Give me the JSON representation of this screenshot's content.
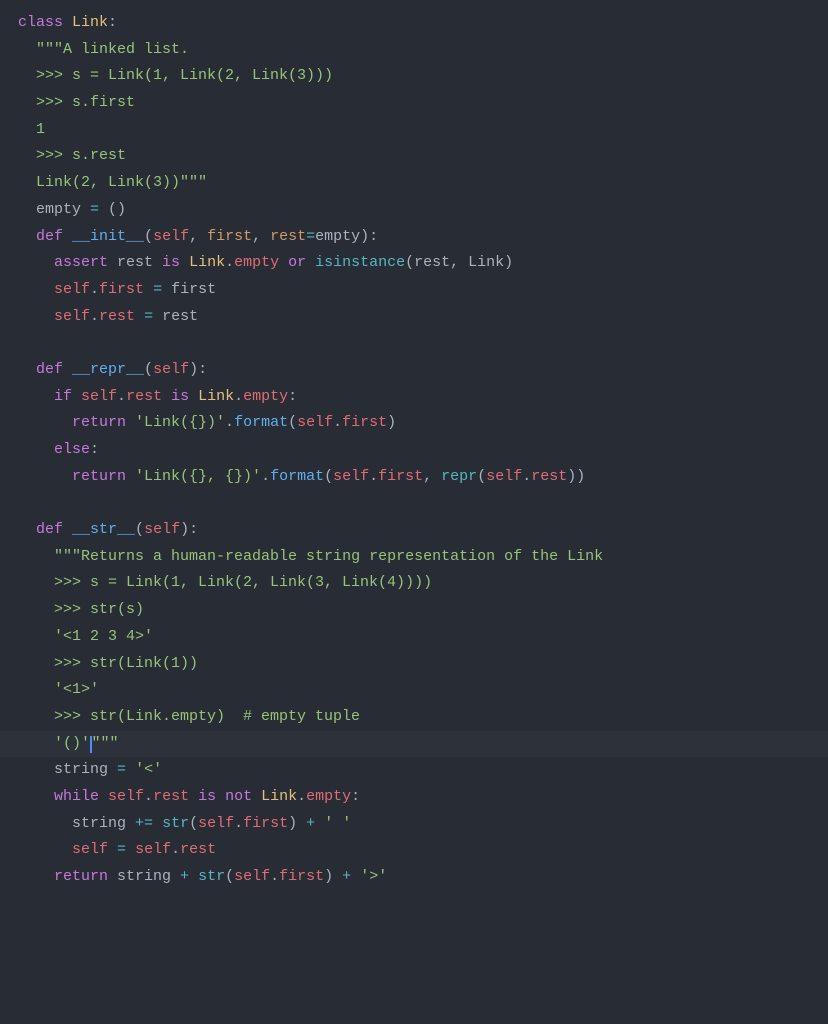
{
  "language": "python",
  "theme": "one-dark",
  "cursor": {
    "line_index": 29,
    "after_token_index": 3
  },
  "highlighted_line_index": 29,
  "lines": [
    [
      {
        "t": "class ",
        "c": "kw"
      },
      {
        "t": "Link",
        "c": "cls"
      },
      {
        "t": ":",
        "c": "punct"
      }
    ],
    [
      {
        "t": "  ",
        "c": "punct"
      },
      {
        "t": "\"\"\"A linked list.",
        "c": "str"
      }
    ],
    [
      {
        "t": "  >>> s = Link(1, Link(2, Link(3)))",
        "c": "str"
      }
    ],
    [
      {
        "t": "  >>> s.first",
        "c": "str"
      }
    ],
    [
      {
        "t": "  1",
        "c": "str"
      }
    ],
    [
      {
        "t": "  >>> s.rest",
        "c": "str"
      }
    ],
    [
      {
        "t": "  Link(2, Link(3))\"\"\"",
        "c": "str"
      }
    ],
    [
      {
        "t": "  empty ",
        "c": "punct"
      },
      {
        "t": "=",
        "c": "op"
      },
      {
        "t": " ()",
        "c": "punct"
      }
    ],
    [
      {
        "t": "  ",
        "c": "punct"
      },
      {
        "t": "def ",
        "c": "kw"
      },
      {
        "t": "__init__",
        "c": "fn"
      },
      {
        "t": "(",
        "c": "punct"
      },
      {
        "t": "self",
        "c": "self"
      },
      {
        "t": ", ",
        "c": "punct"
      },
      {
        "t": "first",
        "c": "param"
      },
      {
        "t": ", ",
        "c": "punct"
      },
      {
        "t": "rest",
        "c": "param"
      },
      {
        "t": "=",
        "c": "op"
      },
      {
        "t": "empty",
        "c": "punct"
      },
      {
        "t": "):",
        "c": "punct"
      }
    ],
    [
      {
        "t": "    ",
        "c": "punct"
      },
      {
        "t": "assert ",
        "c": "kw"
      },
      {
        "t": "rest ",
        "c": "punct"
      },
      {
        "t": "is ",
        "c": "kw"
      },
      {
        "t": "Link",
        "c": "cls"
      },
      {
        "t": ".",
        "c": "punct"
      },
      {
        "t": "empty",
        "c": "attr"
      },
      {
        "t": " ",
        "c": "punct"
      },
      {
        "t": "or ",
        "c": "kw"
      },
      {
        "t": "isinstance",
        "c": "builtin"
      },
      {
        "t": "(rest, Link)",
        "c": "punct"
      }
    ],
    [
      {
        "t": "    ",
        "c": "punct"
      },
      {
        "t": "self",
        "c": "self"
      },
      {
        "t": ".",
        "c": "punct"
      },
      {
        "t": "first",
        "c": "attr"
      },
      {
        "t": " ",
        "c": "punct"
      },
      {
        "t": "=",
        "c": "op"
      },
      {
        "t": " first",
        "c": "punct"
      }
    ],
    [
      {
        "t": "    ",
        "c": "punct"
      },
      {
        "t": "self",
        "c": "self"
      },
      {
        "t": ".",
        "c": "punct"
      },
      {
        "t": "rest",
        "c": "attr"
      },
      {
        "t": " ",
        "c": "punct"
      },
      {
        "t": "=",
        "c": "op"
      },
      {
        "t": " rest",
        "c": "punct"
      }
    ],
    [
      {
        "t": " ",
        "c": "punct"
      }
    ],
    [
      {
        "t": "  ",
        "c": "punct"
      },
      {
        "t": "def ",
        "c": "kw"
      },
      {
        "t": "__repr__",
        "c": "fn"
      },
      {
        "t": "(",
        "c": "punct"
      },
      {
        "t": "self",
        "c": "self"
      },
      {
        "t": "):",
        "c": "punct"
      }
    ],
    [
      {
        "t": "    ",
        "c": "punct"
      },
      {
        "t": "if ",
        "c": "kw"
      },
      {
        "t": "self",
        "c": "self"
      },
      {
        "t": ".",
        "c": "punct"
      },
      {
        "t": "rest",
        "c": "attr"
      },
      {
        "t": " ",
        "c": "punct"
      },
      {
        "t": "is ",
        "c": "kw"
      },
      {
        "t": "Link",
        "c": "cls"
      },
      {
        "t": ".",
        "c": "punct"
      },
      {
        "t": "empty",
        "c": "attr"
      },
      {
        "t": ":",
        "c": "punct"
      }
    ],
    [
      {
        "t": "      ",
        "c": "punct"
      },
      {
        "t": "return ",
        "c": "kw"
      },
      {
        "t": "'Link({})'",
        "c": "str"
      },
      {
        "t": ".",
        "c": "punct"
      },
      {
        "t": "format",
        "c": "fn"
      },
      {
        "t": "(",
        "c": "punct"
      },
      {
        "t": "self",
        "c": "self"
      },
      {
        "t": ".",
        "c": "punct"
      },
      {
        "t": "first",
        "c": "attr"
      },
      {
        "t": ")",
        "c": "punct"
      }
    ],
    [
      {
        "t": "    ",
        "c": "punct"
      },
      {
        "t": "else",
        "c": "kw"
      },
      {
        "t": ":",
        "c": "punct"
      }
    ],
    [
      {
        "t": "      ",
        "c": "punct"
      },
      {
        "t": "return ",
        "c": "kw"
      },
      {
        "t": "'Link({}, {})'",
        "c": "str"
      },
      {
        "t": ".",
        "c": "punct"
      },
      {
        "t": "format",
        "c": "fn"
      },
      {
        "t": "(",
        "c": "punct"
      },
      {
        "t": "self",
        "c": "self"
      },
      {
        "t": ".",
        "c": "punct"
      },
      {
        "t": "first",
        "c": "attr"
      },
      {
        "t": ", ",
        "c": "punct"
      },
      {
        "t": "repr",
        "c": "builtin"
      },
      {
        "t": "(",
        "c": "punct"
      },
      {
        "t": "self",
        "c": "self"
      },
      {
        "t": ".",
        "c": "punct"
      },
      {
        "t": "rest",
        "c": "attr"
      },
      {
        "t": "))",
        "c": "punct"
      }
    ],
    [
      {
        "t": " ",
        "c": "punct"
      }
    ],
    [
      {
        "t": "  ",
        "c": "punct"
      },
      {
        "t": "def ",
        "c": "kw"
      },
      {
        "t": "__str__",
        "c": "fn"
      },
      {
        "t": "(",
        "c": "punct"
      },
      {
        "t": "self",
        "c": "self"
      },
      {
        "t": "):",
        "c": "punct"
      }
    ],
    [
      {
        "t": "    ",
        "c": "punct"
      },
      {
        "t": "\"\"\"Returns a human-readable string representation of the Link",
        "c": "str"
      }
    ],
    [
      {
        "t": "    >>> s = Link(1, Link(2, Link(3, Link(4))))",
        "c": "str"
      }
    ],
    [
      {
        "t": "    >>> str(s)",
        "c": "str"
      }
    ],
    [
      {
        "t": "    '<1 2 3 4>'",
        "c": "str"
      }
    ],
    [
      {
        "t": "    >>> str(Link(1))",
        "c": "str"
      }
    ],
    [
      {
        "t": "    '<1>'",
        "c": "str"
      }
    ],
    [
      {
        "t": "    >>> str(Link.empty)  # empty tuple",
        "c": "str"
      }
    ],
    [
      {
        "t": "    '()'",
        "c": "str"
      },
      {
        "t": "\"\"\"",
        "c": "str"
      }
    ],
    [
      {
        "t": "    string ",
        "c": "punct"
      },
      {
        "t": "=",
        "c": "op"
      },
      {
        "t": " ",
        "c": "punct"
      },
      {
        "t": "'<'",
        "c": "str"
      }
    ],
    [
      {
        "t": "    ",
        "c": "punct"
      },
      {
        "t": "while ",
        "c": "kw"
      },
      {
        "t": "self",
        "c": "self"
      },
      {
        "t": ".",
        "c": "punct"
      },
      {
        "t": "rest",
        "c": "attr"
      },
      {
        "t": " ",
        "c": "punct"
      },
      {
        "t": "is ",
        "c": "kw"
      },
      {
        "t": "not ",
        "c": "kw"
      },
      {
        "t": "Link",
        "c": "cls"
      },
      {
        "t": ".",
        "c": "punct"
      },
      {
        "t": "empty",
        "c": "attr"
      },
      {
        "t": ":",
        "c": "punct"
      }
    ],
    [
      {
        "t": "      string ",
        "c": "punct"
      },
      {
        "t": "+=",
        "c": "op"
      },
      {
        "t": " ",
        "c": "punct"
      },
      {
        "t": "str",
        "c": "builtin"
      },
      {
        "t": "(",
        "c": "punct"
      },
      {
        "t": "self",
        "c": "self"
      },
      {
        "t": ".",
        "c": "punct"
      },
      {
        "t": "first",
        "c": "attr"
      },
      {
        "t": ") ",
        "c": "punct"
      },
      {
        "t": "+",
        "c": "op"
      },
      {
        "t": " ",
        "c": "punct"
      },
      {
        "t": "' '",
        "c": "str"
      }
    ],
    [
      {
        "t": "      ",
        "c": "punct"
      },
      {
        "t": "self",
        "c": "self"
      },
      {
        "t": " ",
        "c": "punct"
      },
      {
        "t": "=",
        "c": "op"
      },
      {
        "t": " ",
        "c": "punct"
      },
      {
        "t": "self",
        "c": "self"
      },
      {
        "t": ".",
        "c": "punct"
      },
      {
        "t": "rest",
        "c": "attr"
      }
    ],
    [
      {
        "t": "    ",
        "c": "punct"
      },
      {
        "t": "return ",
        "c": "kw"
      },
      {
        "t": "string ",
        "c": "punct"
      },
      {
        "t": "+",
        "c": "op"
      },
      {
        "t": " ",
        "c": "punct"
      },
      {
        "t": "str",
        "c": "builtin"
      },
      {
        "t": "(",
        "c": "punct"
      },
      {
        "t": "self",
        "c": "self"
      },
      {
        "t": ".",
        "c": "punct"
      },
      {
        "t": "first",
        "c": "attr"
      },
      {
        "t": ") ",
        "c": "punct"
      },
      {
        "t": "+",
        "c": "op"
      },
      {
        "t": " ",
        "c": "punct"
      },
      {
        "t": "'>'",
        "c": "str"
      }
    ]
  ]
}
